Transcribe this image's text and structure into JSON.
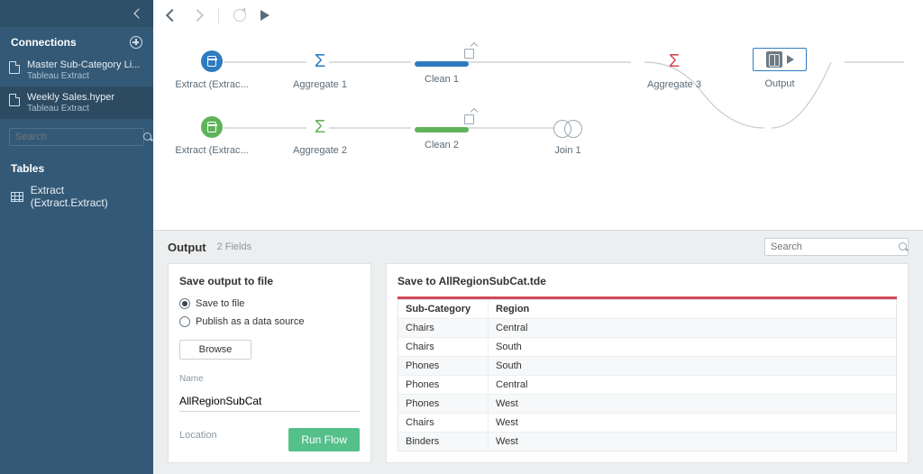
{
  "sidebar": {
    "connections_label": "Connections",
    "plus_tooltip": "Add Connection",
    "items": [
      {
        "name": "Master Sub-Category Li...",
        "sub": "Tableau Extract"
      },
      {
        "name": "Weekly Sales.hyper",
        "sub": "Tableau Extract"
      }
    ],
    "search_placeholder": "Search",
    "tables_label": "Tables",
    "table_entry": "Extract (Extract.Extract)"
  },
  "flow": {
    "nodes": {
      "extract1": "Extract (Extrac...",
      "aggregate1": "Aggregate 1",
      "clean1": "Clean 1",
      "extract2": "Extract (Extrac...",
      "aggregate2": "Aggregate 2",
      "clean2": "Clean 2",
      "join1": "Join 1",
      "aggregate3": "Aggregate 3",
      "output": "Output"
    }
  },
  "bottom": {
    "output_label": "Output",
    "field_count": "2 Fields",
    "search_placeholder": "Search",
    "left": {
      "title": "Save output to file",
      "opt_file": "Save to file",
      "opt_publish": "Publish as a data source",
      "browse": "Browse",
      "name_label": "Name",
      "name_value": "AllRegionSubCat",
      "location_label": "Location",
      "run_flow": "Run Flow"
    },
    "right": {
      "title": "Save to AllRegionSubCat.tde",
      "headers": {
        "c1": "Sub-Category",
        "c2": "Region"
      },
      "rows": [
        {
          "c1": "Chairs",
          "c2": "Central"
        },
        {
          "c1": "Chairs",
          "c2": "South"
        },
        {
          "c1": "Phones",
          "c2": "South"
        },
        {
          "c1": "Phones",
          "c2": "Central"
        },
        {
          "c1": "Phones",
          "c2": "West"
        },
        {
          "c1": "Chairs",
          "c2": "West"
        },
        {
          "c1": "Binders",
          "c2": "West"
        }
      ]
    }
  }
}
